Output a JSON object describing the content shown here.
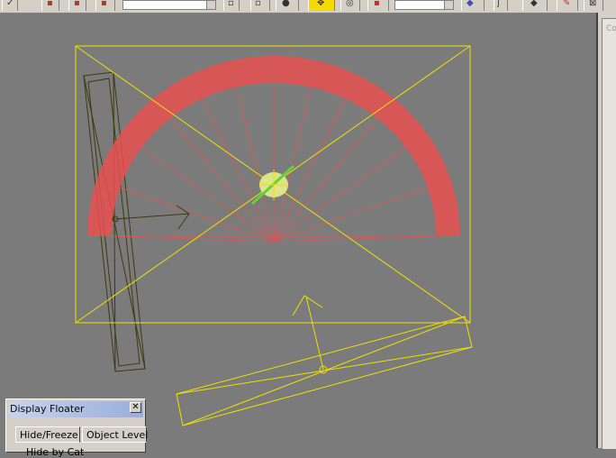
{
  "toolbar": {
    "icons": [
      "select-icon",
      "select-by-name-icon",
      "select-region-icon",
      "window-crossing-icon",
      "move-icon",
      "rotate-icon",
      "scale-icon",
      "snap-icon",
      "mirror-icon",
      "align-icon",
      "layer-manager-icon",
      "render-icon"
    ],
    "active_tool": "move-icon"
  },
  "right_panel": {
    "label": "Co"
  },
  "viewport": {
    "colors": {
      "background": "#7b7b7b",
      "selection_yellow": "#f0e000",
      "light_cone_red": "#e85050",
      "light_point_green": "#80e040",
      "unselected_dark": "#3a3a10"
    }
  },
  "display_floater": {
    "title": "Display Floater",
    "close_glyph": "✕",
    "tabs": [
      {
        "label": "Hide/Freeze"
      },
      {
        "label": "Object Level"
      }
    ],
    "partial_text": "Hide by Cat"
  }
}
